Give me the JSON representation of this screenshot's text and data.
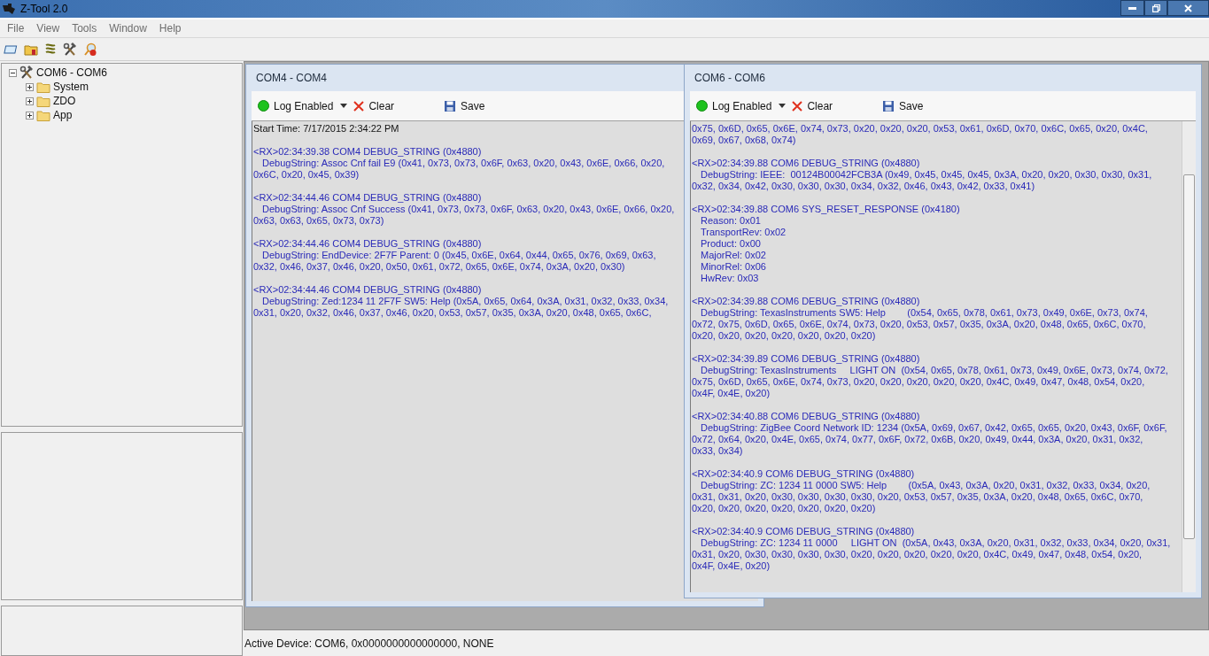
{
  "window": {
    "title": "Z-Tool 2.0"
  },
  "menu": [
    "File",
    "View",
    "Tools",
    "Window",
    "Help"
  ],
  "tree": {
    "label": "COM6 - COM6",
    "expanded": true,
    "children": [
      {
        "label": "System",
        "expanded": false
      },
      {
        "label": "ZDO",
        "expanded": false
      },
      {
        "label": "App",
        "expanded": false
      }
    ]
  },
  "documents": [
    {
      "title": "COM4 - COM4",
      "log_enabled": true,
      "log_label": "Log Enabled",
      "clear_label": "Clear",
      "save_label": "Save",
      "scrollbar": false,
      "start_time": "Start Time: 7/17/2015 2:34:22 PM",
      "entries": [
        {
          "header": "<RX>02:34:39.38 COM4 DEBUG_STRING (0x4880)",
          "lines": [
            {
              "text": "DebugString: Assoc Cnf fail E9 (0x41, 0x73, 0x73, 0x6F, 0x63, 0x20, 0x43, 0x6E, 0x66, 0x20,",
              "indent": true
            },
            {
              "text": "0x6C, 0x20, 0x45, 0x39)",
              "indent": false
            }
          ]
        },
        {
          "header": "<RX>02:34:44.46 COM4 DEBUG_STRING (0x4880)",
          "lines": [
            {
              "text": "DebugString: Assoc Cnf Success (0x41, 0x73, 0x73, 0x6F, 0x63, 0x20, 0x43, 0x6E, 0x66, 0x20,",
              "indent": true
            },
            {
              "text": "0x63, 0x63, 0x65, 0x73, 0x73)",
              "indent": false
            }
          ]
        },
        {
          "header": "<RX>02:34:44.46 COM4 DEBUG_STRING (0x4880)",
          "lines": [
            {
              "text": "DebugString: EndDevice: 2F7F Parent: 0 (0x45, 0x6E, 0x64, 0x44, 0x65, 0x76, 0x69, 0x63,",
              "indent": true
            },
            {
              "text": "0x32, 0x46, 0x37, 0x46, 0x20, 0x50, 0x61, 0x72, 0x65, 0x6E, 0x74, 0x3A, 0x20, 0x30)",
              "indent": false
            }
          ]
        },
        {
          "header": "<RX>02:34:44.46 COM4 DEBUG_STRING (0x4880)",
          "lines": [
            {
              "text": "DebugString: Zed:1234 11 2F7F SW5: Help (0x5A, 0x65, 0x64, 0x3A, 0x31, 0x32, 0x33, 0x34,",
              "indent": true
            },
            {
              "text": "0x31, 0x20, 0x32, 0x46, 0x37, 0x46, 0x20, 0x53, 0x57, 0x35, 0x3A, 0x20, 0x48, 0x65, 0x6C,",
              "indent": false
            }
          ]
        }
      ]
    },
    {
      "title": "COM6 - COM6",
      "log_enabled": true,
      "log_label": "Log Enabled",
      "clear_label": "Clear",
      "save_label": "Save",
      "scrollbar": true,
      "entries": [
        {
          "lines": [
            {
              "text": "0x75, 0x6D, 0x65, 0x6E, 0x74, 0x73, 0x20, 0x20, 0x20, 0x53, 0x61, 0x6D, 0x70, 0x6C, 0x65, 0x20, 0x4C,",
              "indent": false
            },
            {
              "text": "0x69, 0x67, 0x68, 0x74)",
              "indent": false
            }
          ]
        },
        {
          "header": "<RX>02:34:39.88 COM6 DEBUG_STRING (0x4880)",
          "lines": [
            {
              "text": "DebugString: IEEE:  00124B00042FCB3A (0x49, 0x45, 0x45, 0x45, 0x3A, 0x20, 0x20, 0x30, 0x30, 0x31,",
              "indent": true
            },
            {
              "text": "0x32, 0x34, 0x42, 0x30, 0x30, 0x30, 0x34, 0x32, 0x46, 0x43, 0x42, 0x33, 0x41)",
              "indent": false
            }
          ]
        },
        {
          "header": "<RX>02:34:39.88 COM6 SYS_RESET_RESPONSE (0x4180)",
          "lines": [
            {
              "text": "Reason: 0x01",
              "indent": true
            },
            {
              "text": "TransportRev: 0x02",
              "indent": true
            },
            {
              "text": "Product: 0x00",
              "indent": true
            },
            {
              "text": "MajorRel: 0x02",
              "indent": true
            },
            {
              "text": "MinorRel: 0x06",
              "indent": true
            },
            {
              "text": "HwRev: 0x03",
              "indent": true
            }
          ]
        },
        {
          "header": "<RX>02:34:39.88 COM6 DEBUG_STRING (0x4880)",
          "lines": [
            {
              "text": "DebugString: TexasInstruments SW5: Help        (0x54, 0x65, 0x78, 0x61, 0x73, 0x49, 0x6E, 0x73, 0x74,",
              "indent": true
            },
            {
              "text": "0x72, 0x75, 0x6D, 0x65, 0x6E, 0x74, 0x73, 0x20, 0x53, 0x57, 0x35, 0x3A, 0x20, 0x48, 0x65, 0x6C, 0x70,",
              "indent": false
            },
            {
              "text": "0x20, 0x20, 0x20, 0x20, 0x20, 0x20, 0x20)",
              "indent": false
            }
          ]
        },
        {
          "header": "<RX>02:34:39.89 COM6 DEBUG_STRING (0x4880)",
          "lines": [
            {
              "text": "DebugString: TexasInstruments     LIGHT ON  (0x54, 0x65, 0x78, 0x61, 0x73, 0x49, 0x6E, 0x73, 0x74, 0x72,",
              "indent": true
            },
            {
              "text": "0x75, 0x6D, 0x65, 0x6E, 0x74, 0x73, 0x20, 0x20, 0x20, 0x20, 0x20, 0x4C, 0x49, 0x47, 0x48, 0x54, 0x20,",
              "indent": false
            },
            {
              "text": "0x4F, 0x4E, 0x20)",
              "indent": false
            }
          ]
        },
        {
          "header": "<RX>02:34:40.88 COM6 DEBUG_STRING (0x4880)",
          "lines": [
            {
              "text": "DebugString: ZigBee Coord Network ID: 1234 (0x5A, 0x69, 0x67, 0x42, 0x65, 0x65, 0x20, 0x43, 0x6F, 0x6F,",
              "indent": true
            },
            {
              "text": "0x72, 0x64, 0x20, 0x4E, 0x65, 0x74, 0x77, 0x6F, 0x72, 0x6B, 0x20, 0x49, 0x44, 0x3A, 0x20, 0x31, 0x32,",
              "indent": false
            },
            {
              "text": "0x33, 0x34)",
              "indent": false
            }
          ]
        },
        {
          "header": "<RX>02:34:40.9 COM6 DEBUG_STRING (0x4880)",
          "lines": [
            {
              "text": "DebugString: ZC: 1234 11 0000 SW5: Help        (0x5A, 0x43, 0x3A, 0x20, 0x31, 0x32, 0x33, 0x34, 0x20,",
              "indent": true
            },
            {
              "text": "0x31, 0x31, 0x20, 0x30, 0x30, 0x30, 0x30, 0x20, 0x53, 0x57, 0x35, 0x3A, 0x20, 0x48, 0x65, 0x6C, 0x70,",
              "indent": false
            },
            {
              "text": "0x20, 0x20, 0x20, 0x20, 0x20, 0x20, 0x20)",
              "indent": false
            }
          ]
        },
        {
          "header": "<RX>02:34:40.9 COM6 DEBUG_STRING (0x4880)",
          "lines": [
            {
              "text": "DebugString: ZC: 1234 11 0000     LIGHT ON  (0x5A, 0x43, 0x3A, 0x20, 0x31, 0x32, 0x33, 0x34, 0x20, 0x31,",
              "indent": true
            },
            {
              "text": "0x31, 0x20, 0x30, 0x30, 0x30, 0x30, 0x20, 0x20, 0x20, 0x20, 0x20, 0x4C, 0x49, 0x47, 0x48, 0x54, 0x20,",
              "indent": false
            },
            {
              "text": "0x4F, 0x4E, 0x20)",
              "indent": false
            }
          ]
        }
      ]
    }
  ],
  "status_bar": "Active Device: COM6, 0x0000000000000000, NONE"
}
